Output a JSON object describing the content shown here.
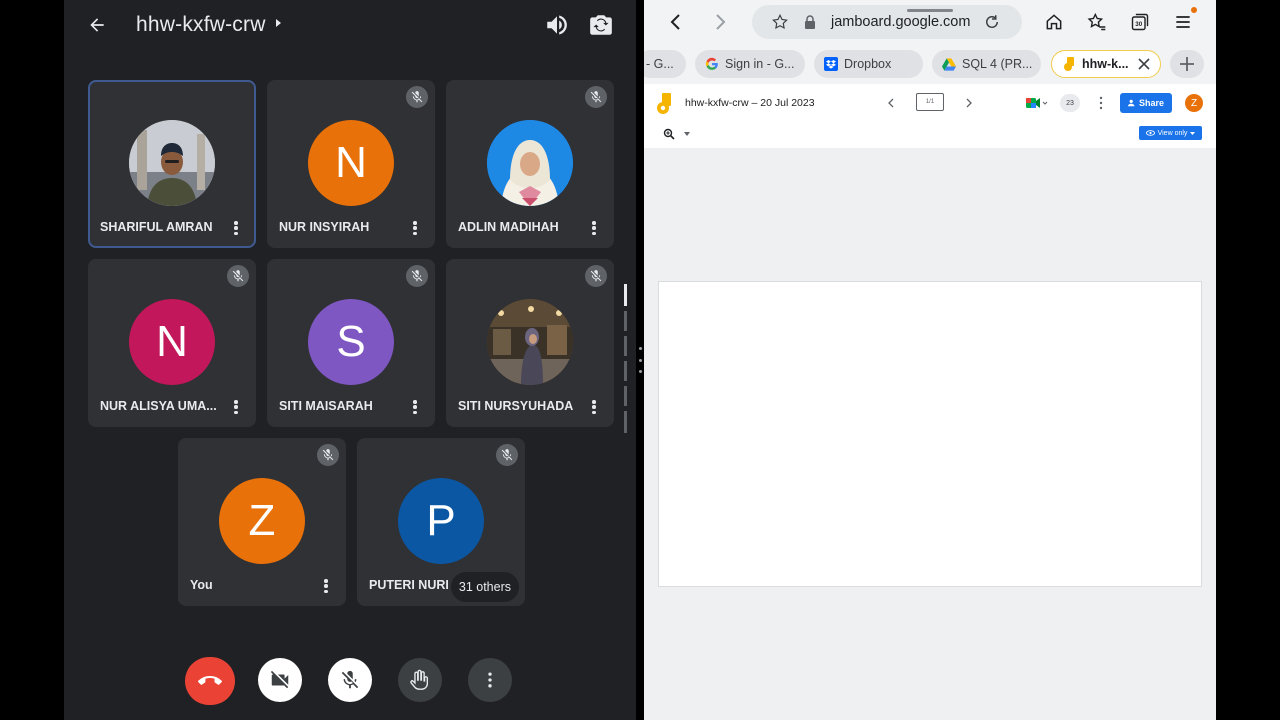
{
  "meet": {
    "meeting_code": "hhw-kxfw-crw",
    "participants": [
      {
        "name": "SHARIFUL AMRAN",
        "initial": "",
        "avatar_color": "#b8b9bd",
        "avatar_type": "photo-man",
        "muted": false,
        "active": true
      },
      {
        "name": "NUR INSYIRAH",
        "initial": "N",
        "avatar_color": "#e8710a",
        "avatar_type": "letter",
        "muted": true,
        "active": false
      },
      {
        "name": "ADLIN MADIHAH",
        "initial": "",
        "avatar_color": "#1e88e5",
        "avatar_type": "photo-woman",
        "muted": true,
        "active": false
      },
      {
        "name": "NUR ALISYA UMA...",
        "initial": "N",
        "avatar_color": "#c2185b",
        "avatar_type": "letter",
        "muted": true,
        "active": false
      },
      {
        "name": "SITI MAISARAH",
        "initial": "S",
        "avatar_color": "#7e57c2",
        "avatar_type": "letter",
        "muted": true,
        "active": false
      },
      {
        "name": "SITI NURSYUHADA",
        "initial": "",
        "avatar_color": "#5d4037",
        "avatar_type": "photo-mall",
        "muted": true,
        "active": false
      },
      {
        "name": "You",
        "initial": "Z",
        "avatar_color": "#e8710a",
        "avatar_type": "letter",
        "muted": true,
        "active": false
      },
      {
        "name": "PUTERI NURI",
        "initial": "P",
        "avatar_color": "#0b57a4",
        "avatar_type": "letter",
        "muted": true,
        "active": false
      }
    ],
    "others_label": "31 others",
    "colors": {
      "end_call": "#ea4335",
      "panel_bg": "#202124",
      "tile_bg": "#303134",
      "control_bg": "#3c4043"
    }
  },
  "browser": {
    "url": "jamboard.google.com",
    "tabs": [
      {
        "label": "- G...",
        "icon": "generic-tab-icon"
      },
      {
        "label": "Sign in - G...",
        "icon": "google-g-icon"
      },
      {
        "label": "Dropbox",
        "icon": "dropbox-icon"
      },
      {
        "label": "SQL 4 (PR...",
        "icon": "google-drive-icon"
      },
      {
        "label": "hhw-k...",
        "icon": "jamboard-icon",
        "active": true
      }
    ],
    "tab_count": "30",
    "jamboard": {
      "title": "hhw-kxfw-crw – 20 Jul 2023",
      "frame_counter": "1/1",
      "participant_count": "23",
      "share_label": "Share",
      "account_initial": "Z",
      "view_only_label": "View only"
    }
  }
}
